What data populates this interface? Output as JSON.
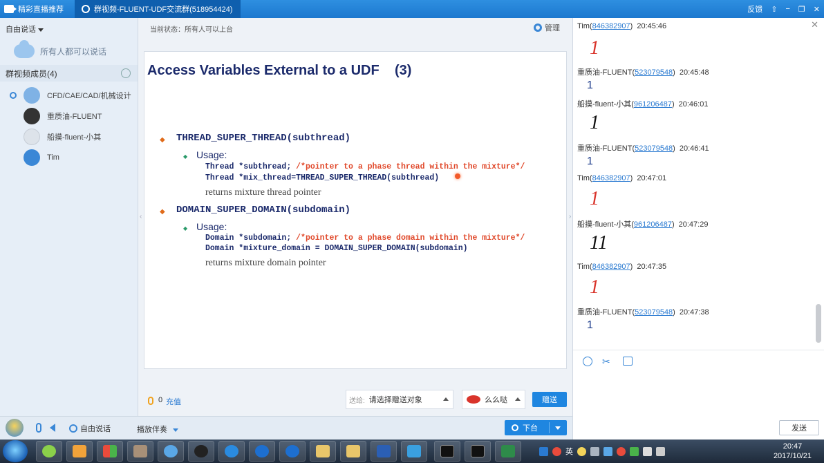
{
  "titlebar": {
    "tab1_label": "精彩直播推荐",
    "tab2_label": "群视频-FLUENT-UDF交流群(518954424)",
    "btn_feedback": "反馈",
    "btn_skin": "⇧",
    "btn_min": "−",
    "btn_max": "❐",
    "btn_close": "✕"
  },
  "left": {
    "mode_label": "自由说话",
    "all_talk": "所有人都可以说话",
    "members_header": "群视频成员(4)",
    "members": [
      {
        "name": "CFD/CAE/CAD/机械设计",
        "avatar_color": "#7fb2e5"
      },
      {
        "name": "重质油-FLUENT",
        "avatar_color": "#333333"
      },
      {
        "name": "船摸-fluent-小其",
        "avatar_color": "#dde3ea"
      },
      {
        "name": "Tim",
        "avatar_color": "#3a87d6"
      }
    ]
  },
  "center": {
    "status": "当前状态：所有人可以上台",
    "manage": "管理",
    "slide": {
      "title": "Access Variables External to a UDF    (3)",
      "bullet": "◆",
      "subbullet": "◆",
      "item1": "THREAD_SUPER_THREAD(subthread)",
      "usage1": "Usage:",
      "code1a": "Thread *subthread;",
      "cmt1a": " /*pointer to a phase thread within the mixture*/",
      "code1b": "Thread *mix_thread=THREAD_SUPER_THREAD(subthread)",
      "ret1": "returns mixture thread pointer",
      "item2": "DOMAIN_SUPER_DOMAIN(subdomain)",
      "usage2": "Usage:",
      "code2a": "Domain *subdomain;",
      "cmt2a": " /*pointer to a phase domain within the mixture*/",
      "code2b": "Domain *mixture_domain = DOMAIN_SUPER_DOMAIN(subdomain)",
      "ret2": "returns mixture domain pointer"
    },
    "gift": {
      "coins": "0",
      "recharge": "充值",
      "target_label": "送给:",
      "target_value": "请选择赠送对象",
      "gift_name": "么么哒",
      "send": "赠送"
    }
  },
  "bottom": {
    "freetalk": "自由说话",
    "accompany": "播放伴奏",
    "stage": "下台"
  },
  "chat": {
    "close": "✕",
    "messages": [
      {
        "name": "Tim(",
        "uid": "846382907",
        "end": ")",
        "time": "20:45:46",
        "body": "1",
        "style": "hand",
        "color": "#d9342b"
      },
      {
        "name": "重质油-FLUENT(",
        "uid": "523079548",
        "end": ")",
        "time": "20:45:48",
        "body": "1",
        "style": "plain",
        "color": "#1b3a8a"
      },
      {
        "name": "船摸-fluent-小其(",
        "uid": "961206487",
        "end": ")",
        "time": "20:46:01",
        "body": "1",
        "style": "hand",
        "color": "#111111"
      },
      {
        "name": "重质油-FLUENT(",
        "uid": "523079548",
        "end": ")",
        "time": "20:46:41",
        "body": "1",
        "style": "plain",
        "color": "#1b3a8a"
      },
      {
        "name": "Tim(",
        "uid": "846382907",
        "end": ")",
        "time": "20:47:01",
        "body": "1",
        "style": "hand",
        "color": "#d9342b"
      },
      {
        "name": "船摸-fluent-小其(",
        "uid": "961206487",
        "end": ")",
        "time": "20:47:29",
        "body": "11",
        "style": "hand",
        "color": "#111111"
      },
      {
        "name": "Tim(",
        "uid": "846382907",
        "end": ")",
        "time": "20:47:35",
        "body": "1",
        "style": "hand",
        "color": "#d9342b"
      },
      {
        "name": "重质油-FLUENT(",
        "uid": "523079548",
        "end": ")",
        "time": "20:47:38",
        "body": "1",
        "style": "plain",
        "color": "#1b3a8a"
      }
    ],
    "send": "发送"
  },
  "taskbar": {
    "apps": [
      "chat-app-icon",
      "folder-app-icon",
      "grid-app-icon",
      "mosaic-app-icon",
      "webcam-app-icon",
      "qq-penguin-icon",
      "sogou-icon",
      "teamviewer-icon",
      "teamviewer-icon-2",
      "folder-icon",
      "folder-icon-2",
      "word-icon",
      "book-icon",
      "cmd-icon",
      "cmd-icon-2",
      "excel-icon"
    ],
    "ime_label": "英",
    "time": "20:47",
    "date": "2017/10/21"
  }
}
